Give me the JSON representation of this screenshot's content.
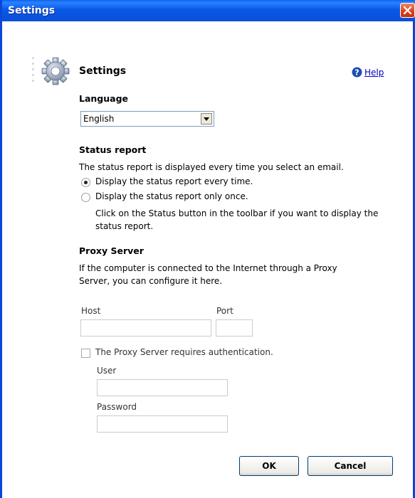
{
  "window": {
    "title": "Settings"
  },
  "header": {
    "title": "Settings",
    "help_label": "Help"
  },
  "language": {
    "heading": "Language",
    "selected": "English"
  },
  "status_report": {
    "heading": "Status report",
    "description": "The status report is displayed every time you select an email.",
    "option_every_time": "Display the status report every time.",
    "option_once": "Display the status report only once.",
    "note_line1": "Click on the Status button in the toolbar if you want to display the",
    "note_line2": "status report.",
    "selected_option": "every_time"
  },
  "proxy": {
    "heading": "Proxy Server",
    "description_line1": "If the computer is connected to the Internet through a Proxy",
    "description_line2": "Server, you can configure it here.",
    "host_label": "Host",
    "host_value": "",
    "port_label": "Port",
    "port_value": "",
    "auth_label": "The Proxy Server requires authentication.",
    "auth_checked": false,
    "user_label": "User",
    "user_value": "",
    "password_label": "Password",
    "password_value": ""
  },
  "buttons": {
    "ok": "OK",
    "cancel": "Cancel"
  },
  "colors": {
    "titlebar": "#0a58e8",
    "close": "#d8401c",
    "link": "#0000c0"
  }
}
